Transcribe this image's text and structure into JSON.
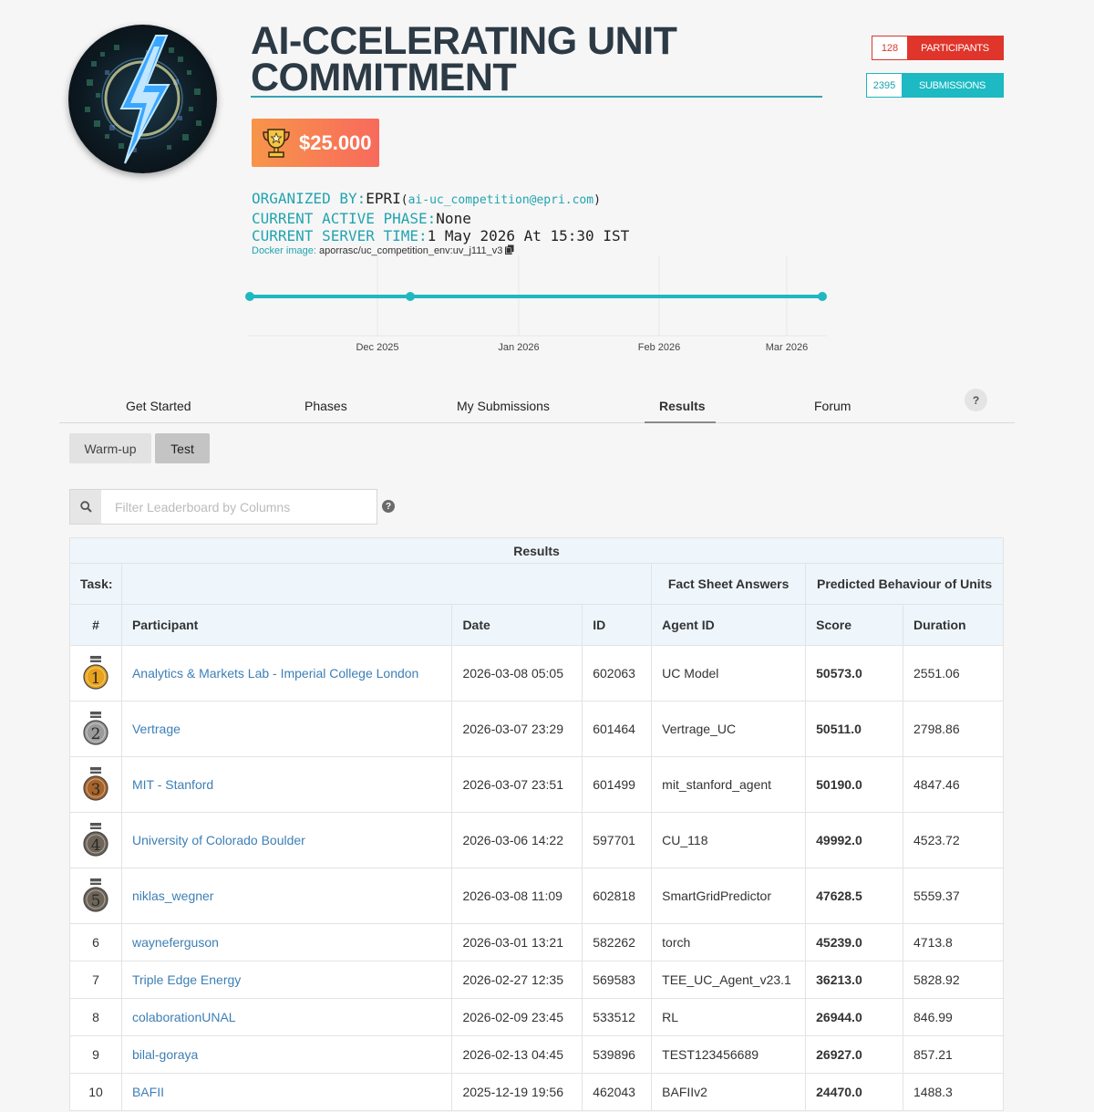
{
  "competition": {
    "title_line1": "AI-CCELERATING UNIT",
    "title_line2": "COMMITMENT",
    "prize": "$25.000"
  },
  "stats": {
    "participants_count": "128",
    "participants_label": "PARTICIPANTS",
    "submissions_count": "2395",
    "submissions_label": "SUBMISSIONS"
  },
  "meta": {
    "organized_by_label": "ORGANIZED BY:",
    "organizer": "EPRI",
    "email": "ai-uc_competition@epri.com",
    "active_phase_label": "CURRENT ACTIVE PHASE:",
    "active_phase": "None",
    "server_time_label": "CURRENT SERVER TIME:",
    "server_time": "1 May 2026 At 15:30 IST",
    "docker_label": "Docker image:",
    "docker_image": "aporrasc/uc_competition_env:uv_j111_v3"
  },
  "timeline": {
    "ticks": [
      "Dec 2025",
      "Jan 2026",
      "Feb 2026",
      "Mar 2026"
    ],
    "line_color": "#1fb8c1"
  },
  "tabs": [
    "Get Started",
    "Phases",
    "My Submissions",
    "Results",
    "Forum"
  ],
  "active_tab": "Results",
  "help_label": "?",
  "phases": {
    "warmup": "Warm-up",
    "test": "Test"
  },
  "filter": {
    "placeholder": "Filter Leaderboard by Columns"
  },
  "table": {
    "caption": "Results",
    "task_label": "Task:",
    "group_fact_sheet": "Fact Sheet Answers",
    "group_predicted": "Predicted Behaviour of Units",
    "columns": [
      "#",
      "Participant",
      "Date",
      "ID",
      "Agent ID",
      "Score",
      "Duration"
    ],
    "rows": [
      {
        "rank": "1",
        "participant": "Analytics & Markets Lab - Imperial College London",
        "date": "2026-03-08 05:05",
        "id": "602063",
        "agent": "UC Model",
        "score": "50573.0",
        "duration": "2551.06"
      },
      {
        "rank": "2",
        "participant": "Vertrage",
        "date": "2026-03-07 23:29",
        "id": "601464",
        "agent": "Vertrage_UC",
        "score": "50511.0",
        "duration": "2798.86"
      },
      {
        "rank": "3",
        "participant": "MIT - Stanford",
        "date": "2026-03-07 23:51",
        "id": "601499",
        "agent": "mit_stanford_agent",
        "score": "50190.0",
        "duration": "4847.46"
      },
      {
        "rank": "4",
        "participant": "University of Colorado Boulder",
        "date": "2026-03-06 14:22",
        "id": "597701",
        "agent": "CU_118",
        "score": "49992.0",
        "duration": "4523.72"
      },
      {
        "rank": "5",
        "participant": "niklas_wegner",
        "date": "2026-03-08 11:09",
        "id": "602818",
        "agent": "SmartGridPredictor",
        "score": "47628.5",
        "duration": "5559.37"
      },
      {
        "rank": "6",
        "participant": "wayneferguson",
        "date": "2026-03-01 13:21",
        "id": "582262",
        "agent": "torch",
        "score": "45239.0",
        "duration": "4713.8"
      },
      {
        "rank": "7",
        "participant": "Triple Edge Energy",
        "date": "2026-02-27 12:35",
        "id": "569583",
        "agent": "TEE_UC_Agent_v23.1",
        "score": "36213.0",
        "duration": "5828.92"
      },
      {
        "rank": "8",
        "participant": "colaborationUNAL",
        "date": "2026-02-09 23:45",
        "id": "533512",
        "agent": "RL",
        "score": "26944.0",
        "duration": "846.99"
      },
      {
        "rank": "9",
        "participant": "bilal-goraya",
        "date": "2026-02-13 04:45",
        "id": "539896",
        "agent": "TEST123456689",
        "score": "26927.0",
        "duration": "857.21"
      },
      {
        "rank": "10",
        "participant": "BAFII",
        "date": "2025-12-19 19:56",
        "id": "462043",
        "agent": "BAFIIv2",
        "score": "24470.0",
        "duration": "1488.3"
      }
    ]
  },
  "colors": {
    "accent": "#22a4b0",
    "participants": "#e0352b",
    "submissions": "#1dbac4",
    "link": "#3d7fb5",
    "gold": "#e8a21b",
    "silver": "#9a9a9a",
    "bronze": "#a8642a",
    "dark_medal": "#6e6558"
  }
}
